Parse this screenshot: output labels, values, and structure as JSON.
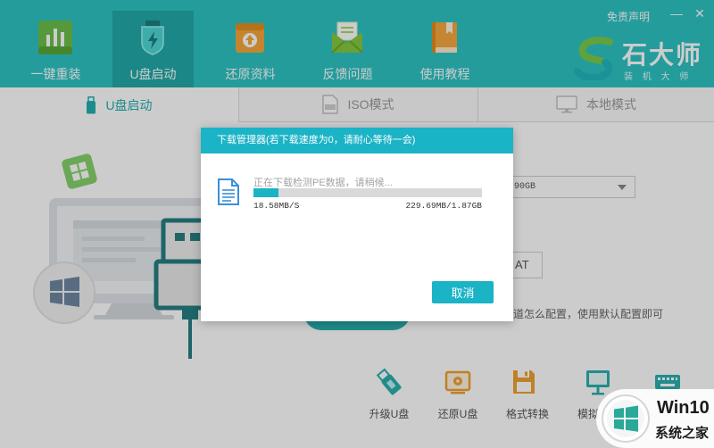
{
  "colors": {
    "header_bg": "#2ec4c4",
    "header_selected_bg": "#22a9a9",
    "accent": "#1bb3c6",
    "overlay": "rgba(0,0,0,0.2)"
  },
  "header": {
    "active_tab_index": 1,
    "tabs": [
      {
        "label": "一键重装",
        "icon": "bar-chart-icon"
      },
      {
        "label": "U盘启动",
        "icon": "usb-shield-icon"
      },
      {
        "label": "还原资料",
        "icon": "restore-box-icon"
      },
      {
        "label": "反馈问题",
        "icon": "envelope-icon"
      },
      {
        "label": "使用教程",
        "icon": "book-icon"
      }
    ],
    "disclaimer": "免责声明",
    "minimize": "—",
    "close": "✕",
    "logo": {
      "name": "石大师",
      "subtitle": "装 机 大 师",
      "icon": "s-swirl-logo"
    }
  },
  "subtabs": {
    "active_index": 0,
    "items": [
      {
        "label": "U盘启动",
        "icon": "usb-icon"
      },
      {
        "label": "ISO模式",
        "icon": "iso-file-icon"
      },
      {
        "label": "本地模式",
        "icon": "monitor-icon"
      }
    ]
  },
  "main": {
    "disk_select_value": "90GB",
    "format_button_label": "AT",
    "hint_text": "道怎么配置，使用默认配置即可",
    "tools": [
      {
        "label": "升级U盘",
        "icon": "usb-upgrade-icon"
      },
      {
        "label": "还原U盘",
        "icon": "usb-restore-icon"
      },
      {
        "label": "格式转换",
        "icon": "floppy-icon"
      },
      {
        "label": "模拟",
        "icon": "monitor-sim-icon"
      },
      {
        "icon": "keyboard-icon"
      }
    ]
  },
  "modal": {
    "title": "下载管理器(若下载速度为0，请耐心等待一会)",
    "status": "正在下载检测PE数据，请稍候...",
    "progress": 0.11,
    "speed": "18.58MB/S",
    "size": "229.69MB/1.87GB",
    "cancel": "取消"
  },
  "watermark": {
    "brand": "Win10",
    "text": "系统之家"
  }
}
